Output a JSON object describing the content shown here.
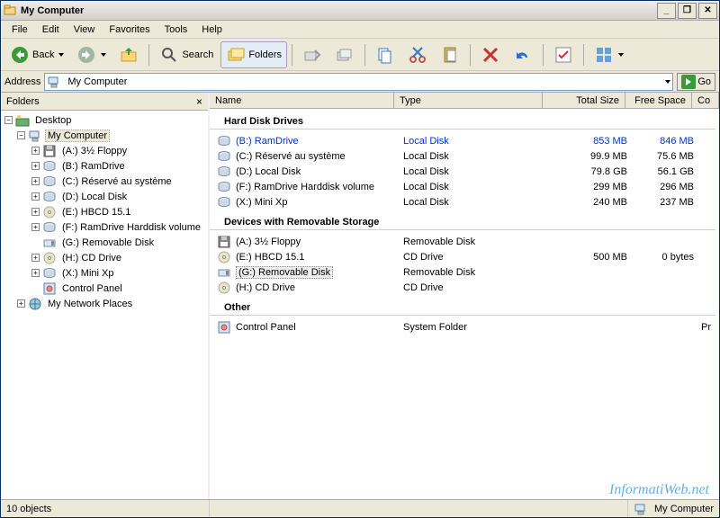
{
  "window": {
    "title": "My Computer"
  },
  "menus": [
    "File",
    "Edit",
    "View",
    "Favorites",
    "Tools",
    "Help"
  ],
  "toolbar": {
    "back": "Back",
    "search": "Search",
    "folders": "Folders"
  },
  "address": {
    "label": "Address",
    "value": "My Computer",
    "go": "Go"
  },
  "sidebar": {
    "title": "Folders",
    "tree": {
      "desktop": "Desktop",
      "mycomputer": "My Computer",
      "items": [
        "(A:) 3½ Floppy",
        "(B:) RamDrive",
        "(C:) Réservé au système",
        "(D:) Local Disk",
        "(E:) HBCD 15.1",
        "(F:) RamDrive Harddisk volume",
        "(G:) Removable Disk",
        "(H:) CD Drive",
        "(X:) Mini Xp",
        "Control Panel"
      ],
      "networkplaces": "My Network Places"
    }
  },
  "list": {
    "headers": {
      "name": "Name",
      "type": "Type",
      "total": "Total Size",
      "free": "Free Space",
      "co": "Co"
    },
    "groups": {
      "hdd": "Hard Disk Drives",
      "removable": "Devices with Removable Storage",
      "other": "Other"
    },
    "hdd": [
      {
        "name": "(B:) RamDrive",
        "type": "Local Disk",
        "total": "853 MB",
        "free": "846 MB",
        "hl": true
      },
      {
        "name": "(C:) Réservé au système",
        "type": "Local Disk",
        "total": "99.9 MB",
        "free": "75.6 MB"
      },
      {
        "name": "(D:) Local Disk",
        "type": "Local Disk",
        "total": "79.8 GB",
        "free": "56.1 GB"
      },
      {
        "name": "(F:) RamDrive Harddisk volume",
        "type": "Local Disk",
        "total": "299 MB",
        "free": "296 MB"
      },
      {
        "name": "(X:) Mini Xp",
        "type": "Local Disk",
        "total": "240 MB",
        "free": "237 MB"
      }
    ],
    "removable": [
      {
        "name": "(A:) 3½ Floppy",
        "type": "Removable Disk",
        "total": "",
        "free": ""
      },
      {
        "name": "(E:) HBCD 15.1",
        "type": "CD Drive",
        "total": "500 MB",
        "free": "0 bytes"
      },
      {
        "name": "(G:) Removable Disk",
        "type": "Removable Disk",
        "total": "",
        "free": "",
        "sel": true
      },
      {
        "name": "(H:) CD Drive",
        "type": "CD Drive",
        "total": "",
        "free": ""
      }
    ],
    "other": [
      {
        "name": "Control Panel",
        "type": "System Folder",
        "total": "",
        "free": "",
        "co": "Pr"
      }
    ]
  },
  "status": {
    "objects": "10 objects",
    "location": "My Computer"
  },
  "watermark": "InformatiWeb.net"
}
